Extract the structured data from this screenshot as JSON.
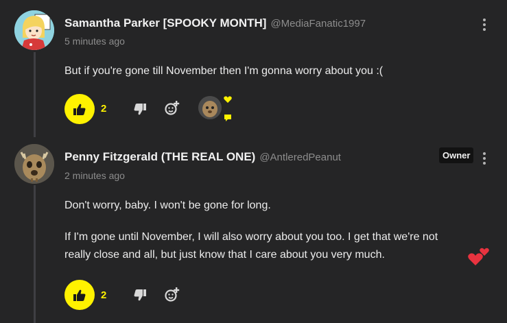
{
  "comments": [
    {
      "author": "Samantha Parker [SPOOKY MONTH]",
      "handle": "@MediaFanatic1997",
      "time": "5 minutes ago",
      "paragraphs": [
        "But if you're gone till November then I'm gonna worry about you :("
      ],
      "likes": "2",
      "avatar_icon": "cartoon-girl-avatar",
      "reaction_icon": "bear-reaction-avatar"
    },
    {
      "author": "Penny Fitzgerald (THE REAL ONE)",
      "handle": "@AntleredPeanut",
      "time": "2 minutes ago",
      "badge": "Owner",
      "paragraphs": [
        "Don't worry, baby. I won't be gone for long.",
        "If I'm gone until November, I will also worry about you too. I get that we're not really close and all, but just know that I care about you very much."
      ],
      "emoji": "two-hearts-emoji",
      "likes": "2",
      "avatar_icon": "antlered-bear-avatar"
    }
  ],
  "colors": {
    "background": "#252526",
    "accent": "#fff200",
    "muted": "#8d8d8d",
    "heart": "#e8333f"
  }
}
